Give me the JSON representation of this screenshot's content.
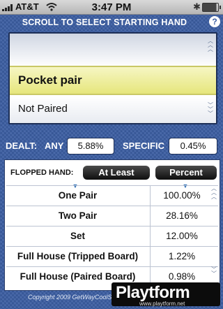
{
  "status_bar": {
    "carrier": "AT&T",
    "time": "3:47 PM",
    "icons": [
      "signal-bars-icon",
      "wifi-icon",
      "bluetooth-icon",
      "battery-icon"
    ]
  },
  "header": {
    "title": "SCROLL TO SELECT STARTING HAND",
    "help_glyph": "?"
  },
  "picker": {
    "items": [
      "",
      "Pocket pair",
      "Not Paired"
    ],
    "selected_index": 1
  },
  "stats": {
    "dealt_label": "DEALT:",
    "any_label": "ANY",
    "any_value": "5.88%",
    "specific_label": "SPECIFIC",
    "specific_value": "0.45%"
  },
  "table": {
    "flopped_label": "FLOPPED HAND:",
    "at_least_button": "At Least",
    "percent_button": "Percent",
    "rows": [
      {
        "name": "One Pair",
        "value": "100.00%"
      },
      {
        "name": "Two Pair",
        "value": "28.16%"
      },
      {
        "name": "Set",
        "value": "12.00%"
      },
      {
        "name": "Full House (Tripped Board)",
        "value": "1.22%"
      },
      {
        "name": "Full House (Paired Board)",
        "value": "0.98%"
      }
    ]
  },
  "footer": {
    "copyright": "Copyright 2009 GetWayCoolS"
  },
  "watermark": {
    "brand": "Playtform",
    "url": "www.playtform.net"
  },
  "colors": {
    "background": "#3a5da2",
    "highlight": "#e6e67c",
    "pill": "#0e0e0e"
  }
}
